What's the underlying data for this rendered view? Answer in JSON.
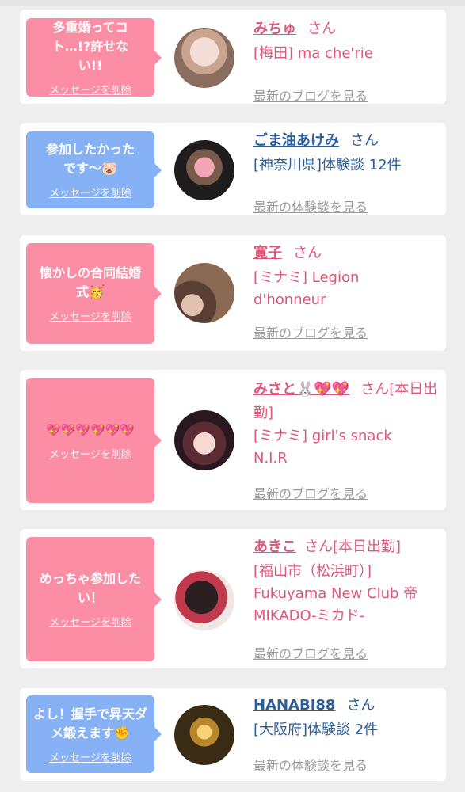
{
  "cards": [
    {
      "message": "多重婚ってコト…!?許せない!!",
      "delete_label": "メッセージを削除",
      "name": "みちゅ",
      "suffix": "さん",
      "shop": "[梅田] ma che'rie",
      "link": "最新のブログを見る"
    },
    {
      "message": "参加したかったです～🐷",
      "delete_label": "メッセージを削除",
      "name": "ごま油あけみ",
      "suffix": "さん",
      "shop": "[神奈川県]体験談 12件",
      "link": "最新の体験談を見る"
    },
    {
      "message": "懐かしの合同結婚式🥳",
      "delete_label": "メッセージを削除",
      "name": "寛子",
      "suffix": "さん",
      "shop": "[ミナミ] Legion d'honneur",
      "link": "最新のブログを見る"
    },
    {
      "message": "💖💖💖💖💖💖",
      "delete_label": "メッセージを削除",
      "name": "みさと🐰💖💖",
      "suffix": "さん[本日出勤]",
      "shop": "[ミナミ] girl's snack N.I.R",
      "link": "最新のブログを見る"
    },
    {
      "message": "めっちゃ参加したい！",
      "delete_label": "メッセージを削除",
      "name": "あきこ",
      "suffix": "さん[本日出勤]",
      "shop": "[福山市（松浜町）] Fukuyama New Club 帝 MIKADO-ミカド-",
      "link": "最新のブログを見る"
    },
    {
      "message": "よし！握手で昇天ダメ鍛えます✊",
      "delete_label": "メッセージを削除",
      "name": "HANABI88",
      "suffix": "さん",
      "shop": "[大阪府]体験談 2件",
      "link": "最新の体験談を見る"
    }
  ]
}
